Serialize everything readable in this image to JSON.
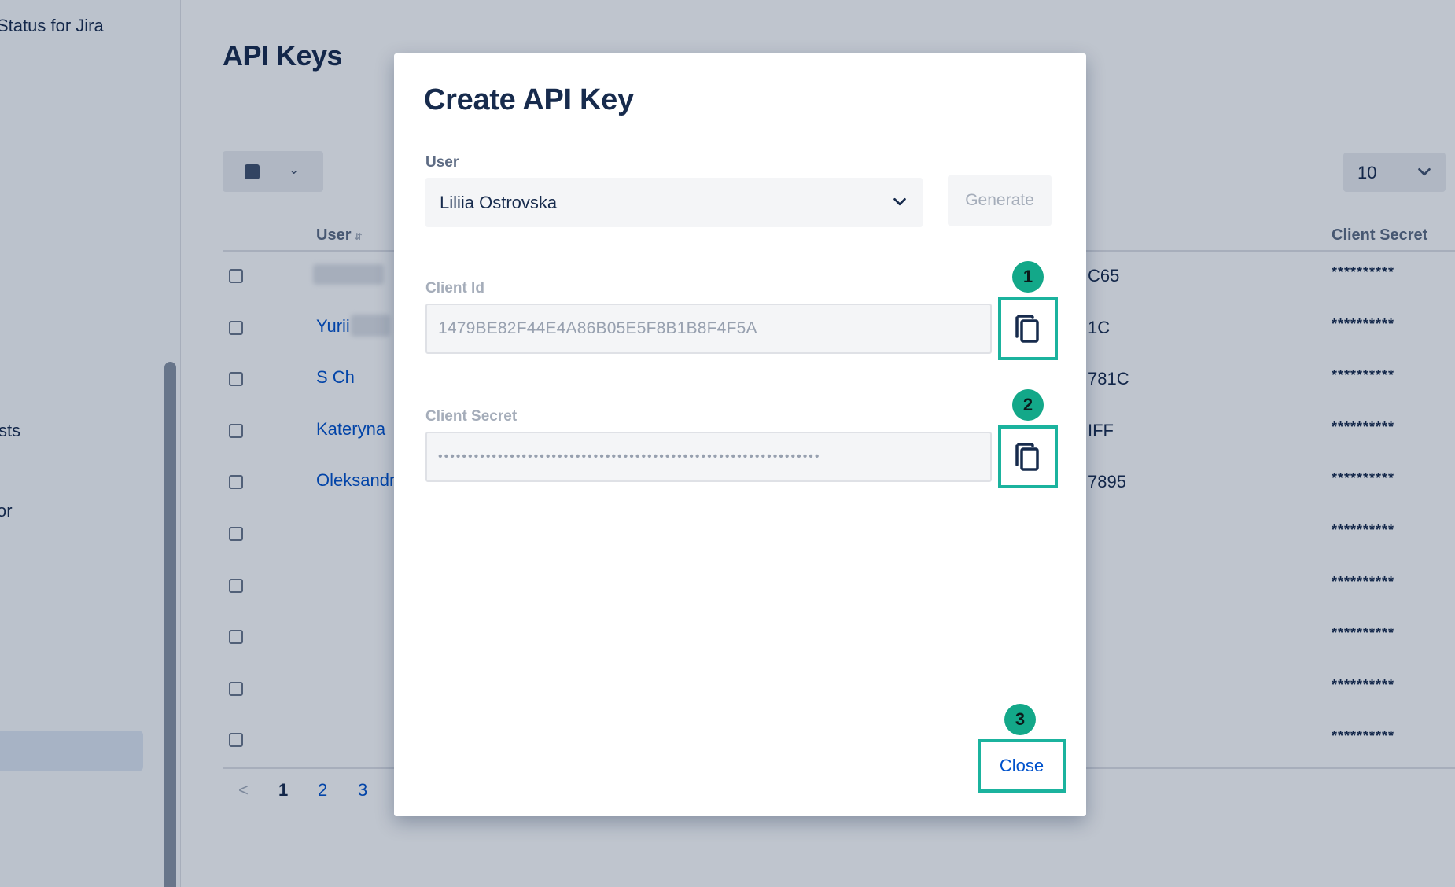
{
  "sidebar": {
    "app_title": "Status for Jira",
    "partial_items": [
      "sts",
      "or"
    ]
  },
  "page": {
    "title": "API Keys",
    "per_page": "10"
  },
  "table": {
    "headers": {
      "user": "User",
      "client_secret": "Client Secret"
    },
    "rows": [
      {
        "user": "",
        "client_id_tail": "C65",
        "secret": "**********"
      },
      {
        "user": "Yurii",
        "client_id_tail": "1C",
        "secret": "**********"
      },
      {
        "user": "S Ch",
        "client_id_tail": "781C",
        "secret": "**********"
      },
      {
        "user": "Kateryna",
        "client_id_tail": "IFF",
        "secret": "**********"
      },
      {
        "user": "Oleksandr",
        "client_id_tail": "7895",
        "secret": "**********"
      },
      {
        "user": "",
        "client_id_tail": "",
        "secret": "**********"
      },
      {
        "user": "",
        "client_id_tail": "",
        "secret": "**********"
      },
      {
        "user": "",
        "client_id_tail": "",
        "secret": "**********"
      },
      {
        "user": "",
        "client_id_tail": "",
        "secret": "**********"
      },
      {
        "user": "",
        "client_id_tail": "",
        "secret": "**********"
      }
    ],
    "pagination": {
      "prev": "<",
      "pages": [
        "1",
        "2",
        "3"
      ]
    }
  },
  "modal": {
    "title": "Create API Key",
    "user_label": "User",
    "user_value": "Liliia Ostrovska",
    "generate_label": "Generate",
    "client_id_label": "Client Id",
    "client_id_value": "1479BE82F44E4A86B05E5F8B1B8F4F5A",
    "client_secret_label": "Client Secret",
    "client_secret_value": "••••••••••••••••••••••••••••••••••••••••••••••••••••••••••••••••",
    "close_label": "Close",
    "step_badges": [
      "1",
      "2",
      "3"
    ]
  },
  "colors": {
    "highlight": "#1bb39e",
    "badge": "#13a889",
    "link": "#0052cc"
  }
}
